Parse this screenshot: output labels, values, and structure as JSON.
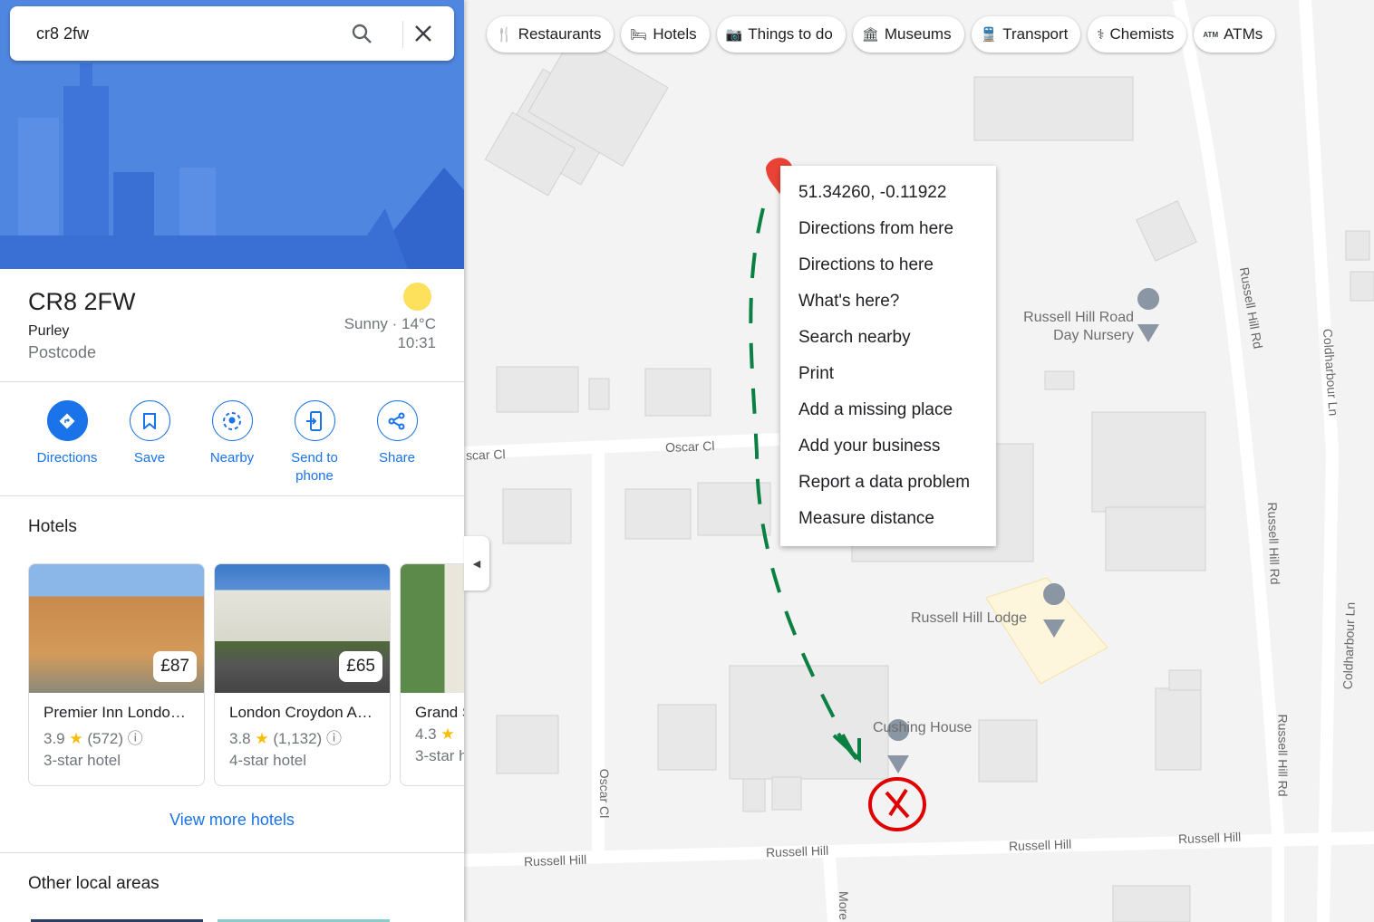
{
  "search": {
    "value": "cr8 2fw"
  },
  "place": {
    "title": "CR8 2FW",
    "locality": "Purley",
    "type": "Postcode",
    "weather": "Sunny · 14°C",
    "time": "10:31"
  },
  "actions": [
    {
      "label": "Directions",
      "icon": "directions-icon"
    },
    {
      "label": "Save",
      "icon": "bookmark-icon"
    },
    {
      "label": "Nearby",
      "icon": "nearby-icon"
    },
    {
      "label": "Send to phone",
      "icon": "send-to-phone-icon"
    },
    {
      "label": "Share",
      "icon": "share-icon"
    }
  ],
  "hotels": {
    "heading": "Hotels",
    "items": [
      {
        "name": "Premier Inn Londo…",
        "rating": "3.9",
        "reviews": "(572)",
        "type": "3-star hotel",
        "price": "£87"
      },
      {
        "name": "London Croydon A…",
        "rating": "3.8",
        "reviews": "(1,132)",
        "type": "4-star hotel",
        "price": "£65"
      },
      {
        "name": "Grand S",
        "rating": "4.3",
        "reviews": "",
        "type": "3-star h",
        "price": ""
      }
    ],
    "more": "View more hotels"
  },
  "other_heading": "Other local areas",
  "chips": [
    {
      "label": "Restaurants",
      "icon": "restaurant-icon"
    },
    {
      "label": "Hotels",
      "icon": "hotel-icon"
    },
    {
      "label": "Things to do",
      "icon": "camera-icon"
    },
    {
      "label": "Museums",
      "icon": "museum-icon"
    },
    {
      "label": "Transport",
      "icon": "train-icon"
    },
    {
      "label": "Chemists",
      "icon": "pharmacy-icon"
    },
    {
      "label": "ATMs",
      "icon": "atm-icon"
    }
  ],
  "context_menu": [
    "51.34260, -0.11922",
    "Directions from here",
    "Directions to here",
    "What's here?",
    "Search nearby",
    "Print",
    "Add a missing place",
    "Add your business",
    "Report a data problem",
    "Measure distance"
  ],
  "map_labels": {
    "nursery": "Russell Hill Road Day Nursery",
    "lodge": "Russell Hill Lodge",
    "cushing": "Cushing House"
  },
  "roads": {
    "oscar1": "scar Cl",
    "oscar2": "Oscar Cl",
    "oscar3": "Oscar Cl",
    "rh1": "Russell Hill",
    "rh2": "Russell Hill",
    "rh3": "Russell Hill",
    "rh4": "Russell Hill",
    "rhr1": "Russell Hill Rd",
    "rhr2": "Russell Hill Rd",
    "rhr3": "Russell Hill Rd",
    "col1": "Coldharbour Ln",
    "col2": "Coldharbour Ln",
    "more": "More"
  },
  "colors": {
    "accent": "#1a73e8",
    "pin": "#ea4335",
    "annotation_arrow": "#0b8043",
    "annotation_x": "#e00000",
    "star": "#fbbc04"
  }
}
